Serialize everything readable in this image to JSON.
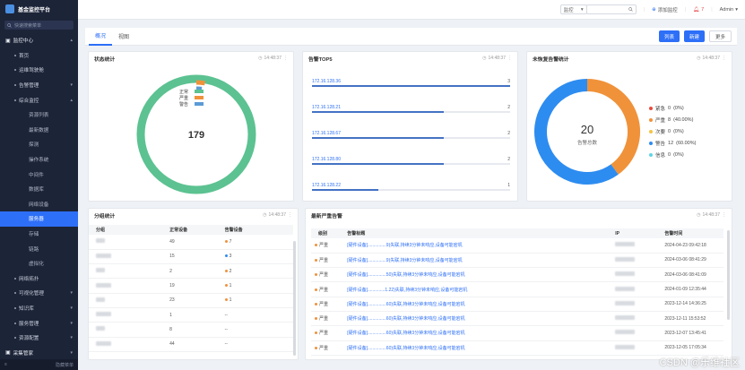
{
  "app": {
    "title": "基金监控平台",
    "search_placeholder": "快速搜索菜单"
  },
  "sidebar": {
    "items": [
      {
        "label": "监控中心",
        "level": 1
      },
      {
        "label": "首页",
        "level": 2
      },
      {
        "label": "运维驾驶舱",
        "level": 2
      },
      {
        "label": "告警管理",
        "level": 2
      },
      {
        "label": "综合监控",
        "level": 2
      },
      {
        "label": "资源列表",
        "level": 3
      },
      {
        "label": "最新数据",
        "level": 3
      },
      {
        "label": "探测",
        "level": 3
      },
      {
        "label": "操作系统",
        "level": 3
      },
      {
        "label": "中间件",
        "level": 3
      },
      {
        "label": "数据库",
        "level": 3
      },
      {
        "label": "网络设备",
        "level": 3
      },
      {
        "label": "服务器",
        "level": 3
      },
      {
        "label": "存储",
        "level": 3
      },
      {
        "label": "链路",
        "level": 3
      },
      {
        "label": "虚拟化",
        "level": 3
      },
      {
        "label": "网络拓扑",
        "level": 2
      },
      {
        "label": "可视化管理",
        "level": 2
      },
      {
        "label": "知识库",
        "level": 2
      },
      {
        "label": "服务管理",
        "level": 2
      },
      {
        "label": "资源配置",
        "level": 2
      },
      {
        "label": "采集管家",
        "level": 1
      }
    ],
    "footer_label": "隐藏菜单"
  },
  "topbar": {
    "select_label": "监控",
    "add_monitor": "添加监控",
    "alert_count": "7",
    "user": "Admin"
  },
  "tabs": [
    {
      "label": "概况"
    },
    {
      "label": "视图"
    }
  ],
  "actions": {
    "list": "列表",
    "new": "新建",
    "more": "更多"
  },
  "timestamp": "14:48:37",
  "status_card": {
    "title": "状态统计",
    "total": "179",
    "legend": [
      "正常",
      "严重",
      "警告"
    ],
    "colors": {
      "normal": "#5cc291",
      "severe": "#f0923a",
      "warning": "#5b9bd5"
    }
  },
  "top5_card": {
    "title": "告警TOP5",
    "rows": [
      {
        "ip": "172.16.128.36",
        "count": "3",
        "frac": 1.0
      },
      {
        "ip": "172.16.128.21",
        "count": "2",
        "frac": 0.667
      },
      {
        "ip": "172.16.128.67",
        "count": "2",
        "frac": 0.667
      },
      {
        "ip": "172.16.128.80",
        "count": "2",
        "frac": 0.667
      },
      {
        "ip": "172.16.128.22",
        "count": "1",
        "frac": 0.333
      }
    ]
  },
  "unresolved_card": {
    "title": "未恢复告警统计",
    "total": "20",
    "total_label": "告警总数",
    "legend": [
      {
        "label": "紧急",
        "count": "0",
        "pct": "(0%)",
        "color": "#e84c3d",
        "value": 0
      },
      {
        "label": "严重",
        "count": "8",
        "pct": "(40.00%)",
        "color": "#f0923a",
        "value": 8
      },
      {
        "label": "次要",
        "count": "0",
        "pct": "(0%)",
        "color": "#f5c342",
        "value": 0
      },
      {
        "label": "警告",
        "count": "12",
        "pct": "(60.00%)",
        "color": "#2d8cf0",
        "value": 12
      },
      {
        "label": "信息",
        "count": "0",
        "pct": "(0%)",
        "color": "#5ed6e6",
        "value": 0
      }
    ]
  },
  "group_card": {
    "title": "分组统计",
    "headers": [
      "分组",
      "正常设备",
      "告警设备"
    ],
    "rows": [
      {
        "normal": "49",
        "alert": "7",
        "alert_color": "#f0923a"
      },
      {
        "normal": "15",
        "alert": "3",
        "alert_color": "#2d8cf0"
      },
      {
        "normal": "2",
        "alert": "2",
        "alert_color": "#f0923a"
      },
      {
        "normal": "19",
        "alert": "1",
        "alert_color": "#f0923a"
      },
      {
        "normal": "23",
        "alert": "1",
        "alert_color": "#f0923a"
      },
      {
        "normal": "1",
        "alert": "--",
        "alert_color": ""
      },
      {
        "normal": "8",
        "alert": "--",
        "alert_color": ""
      },
      {
        "normal": "44",
        "alert": "--",
        "alert_color": ""
      }
    ]
  },
  "latest_card": {
    "title": "最新严重告警",
    "headers": [
      "级别",
      "告警标题",
      "IP",
      "告警时间"
    ],
    "rows": [
      {
        "level": "严重",
        "title": "[硬件设备]...............9)失联,持续3分钟未响应,设备可能宕机",
        "time": "2024-04-23 09:42:18"
      },
      {
        "level": "严重",
        "title": "[硬件设备]...............9)失联,持续3分钟未响应,设备可能宕机",
        "time": "2024-03-06 08:41:29"
      },
      {
        "level": "严重",
        "title": "[硬件设备]...............50)失联,持续3分钟未响应,设备可能宕机",
        "time": "2024-03-06 08:41:09"
      },
      {
        "level": "严重",
        "title": "[硬件设备]..............1.22)失联,持续3分钟未响应,设备可能宕机",
        "time": "2024-01-09 12:35:44"
      },
      {
        "level": "严重",
        "title": "[硬件设备]...............60)失联,持续3分钟未响应,设备可能宕机",
        "time": "2023-12-14 14:36:25"
      },
      {
        "level": "严重",
        "title": "[硬件设备]...............60)失联,持续3分钟未响应,设备可能宕机",
        "time": "2023-12-11 15:53:52"
      },
      {
        "level": "严重",
        "title": "[硬件设备]...............60)失联,持续3分钟未响应,设备可能宕机",
        "time": "2023-12-07 13:45:41"
      },
      {
        "level": "严重",
        "title": "[硬件设备]...............60)失联,持续3分钟未响应,设备可能宕机",
        "time": "2023-12-05 17:05:34"
      }
    ]
  },
  "watermark": "CSDN @乐维社区"
}
